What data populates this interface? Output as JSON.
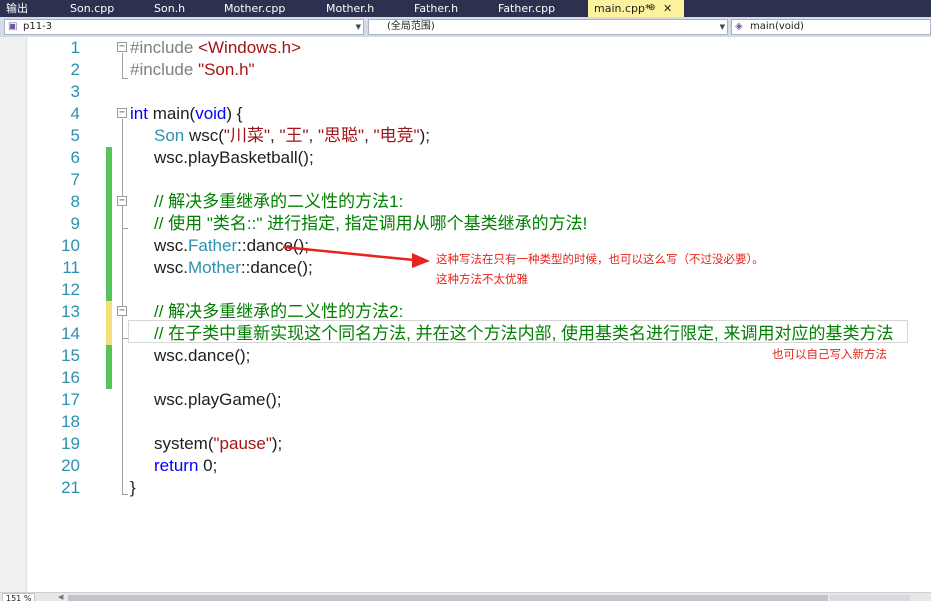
{
  "tabs": [
    {
      "label": "输出"
    },
    {
      "label": "Son.cpp"
    },
    {
      "label": "Son.h"
    },
    {
      "label": "Mother.cpp"
    },
    {
      "label": "Mother.h"
    },
    {
      "label": "Father.h"
    },
    {
      "label": "Father.cpp"
    },
    {
      "label": "main.cpp*",
      "active": true,
      "pin_glyph": "⊕",
      "close_glyph": "✕"
    }
  ],
  "navbar": {
    "project": "p11-3",
    "scope": "(全局范围)",
    "member": "main(void)"
  },
  "editor": {
    "line_numbers": [
      "1",
      "2",
      "3",
      "4",
      "5",
      "6",
      "7",
      "8",
      "9",
      "10",
      "11",
      "12",
      "13",
      "14",
      "15",
      "16",
      "17",
      "18",
      "19",
      "20",
      "21"
    ],
    "code": {
      "l1": {
        "a": "#include ",
        "b": "<Windows.h>"
      },
      "l2": {
        "a": "#include ",
        "b": "\"Son.h\""
      },
      "l4": {
        "a": "int",
        "b": " main(",
        "c": "void",
        "d": ") {"
      },
      "l5": {
        "a": "Son",
        "b": " wsc(",
        "c": "\"川菜\"",
        "d": ", ",
        "e": "\"王\"",
        "f": ", ",
        "g": "\"思聪\"",
        "h": ", ",
        "i": "\"电竞\"",
        "j": ");"
      },
      "l6": "wsc.playBasketball();",
      "l8": "// 解决多重继承的二义性的方法1:",
      "l9": "// 使用 \"类名::\" 进行指定, 指定调用从哪个基类继承的方法!",
      "l10": {
        "a": "wsc.",
        "b": "Father",
        "c": "::dance();"
      },
      "l11": {
        "a": "wsc.",
        "b": "Mother",
        "c": "::dance();"
      },
      "l13": "// 解决多重继承的二义性的方法2:",
      "l14": "// 在子类中重新实现这个同名方法, 并在这个方法内部, 使用基类名进行限定, 来调用对应的基类方法",
      "l15": "wsc.dance();",
      "l17": "wsc.playGame();",
      "l19": {
        "a": "system(",
        "b": "\"pause\"",
        "c": ");"
      },
      "l20": {
        "a": "return",
        "b": " 0;"
      },
      "l21": "}"
    },
    "fold_glyph": "−"
  },
  "annotations": {
    "note1": "这种写法在只有一种类型的时候，也可以这么写（不过没必要）。",
    "note2": "这种方法不太优雅",
    "note3": "也可以自己写入新方法",
    "color": "#e8231d"
  },
  "statusbar": {
    "zoom": "151 %"
  },
  "colors": {
    "keyword": "#0000ff",
    "string": "#a31515",
    "type": "#2b91af",
    "comment": "#008000",
    "preprocessor": "#808080",
    "line_number": "#2b91af",
    "saved_change": "#57c15a",
    "unsaved_change": "#f4e07a",
    "tab_bg": "#2d3150",
    "active_tab_bg": "#fff29d"
  }
}
